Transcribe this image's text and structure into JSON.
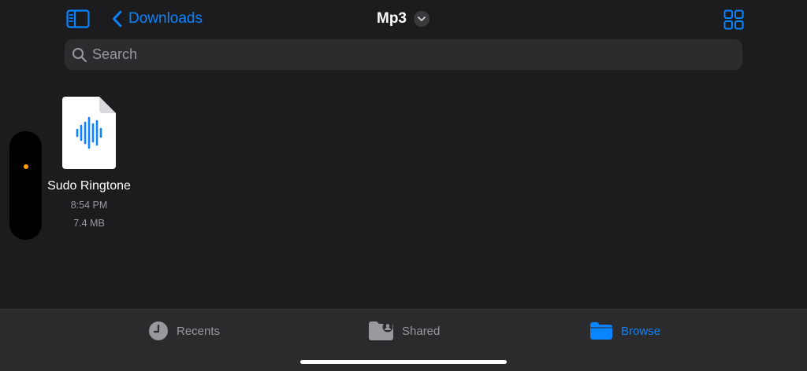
{
  "nav": {
    "back_label": "Downloads",
    "title": "Mp3",
    "sidebar_icon": "sidebar-toggle-icon",
    "view_icon": "grid-view-icon"
  },
  "search": {
    "placeholder": "Search",
    "value": ""
  },
  "files": [
    {
      "name": "Sudo Ringtone",
      "time": "8:54 PM",
      "size": "7.4 MB",
      "icon": "audio-file-icon"
    }
  ],
  "tabs": [
    {
      "label": "Recents",
      "icon": "clock-icon",
      "selected": false
    },
    {
      "label": "Shared",
      "icon": "shared-folder-icon",
      "selected": false
    },
    {
      "label": "Browse",
      "icon": "folder-icon",
      "selected": true
    }
  ],
  "colors": {
    "background": "#1c1c1e",
    "accent": "#0a84ff",
    "secondary_text": "#98989d",
    "tabbar": "#2b2b2d",
    "indicator_dot": "#ff9f0a"
  }
}
